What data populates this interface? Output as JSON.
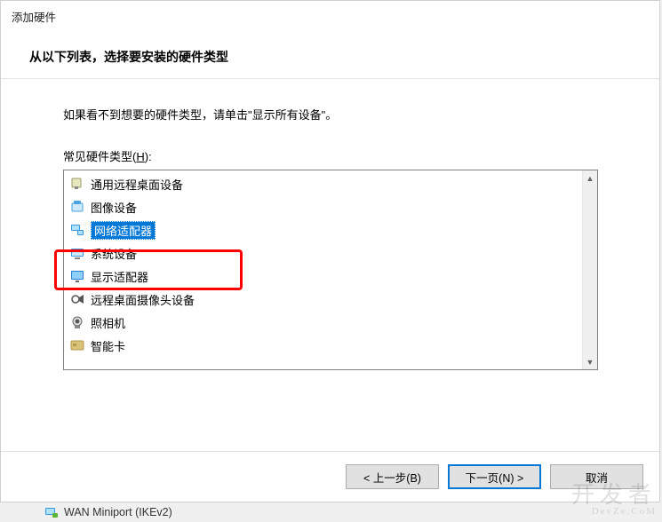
{
  "dialog": {
    "title": "添加硬件",
    "subtitle": "从以下列表，选择要安装的硬件类型",
    "hint": "如果看不到想要的硬件类型，请单击\"显示所有设备\"。",
    "list_label_prefix": "常见硬件类型(",
    "list_label_key": "H",
    "list_label_suffix": "):",
    "items": [
      {
        "label": "通用远程桌面设备",
        "icon": "device-generic"
      },
      {
        "label": "图像设备",
        "icon": "imaging"
      },
      {
        "label": "网络适配器",
        "icon": "network",
        "selected": true
      },
      {
        "label": "系统设备",
        "icon": "system"
      },
      {
        "label": "显示适配器",
        "icon": "display"
      },
      {
        "label": "远程桌面摄像头设备",
        "icon": "rd-camera"
      },
      {
        "label": "照相机",
        "icon": "camera"
      },
      {
        "label": "智能卡",
        "icon": "smartcard"
      }
    ],
    "buttons": {
      "back": "< 上一步(B)",
      "next": "下一页(N) >",
      "cancel": "取消"
    }
  },
  "watermark": {
    "main": "开发者",
    "sub": "DevZe.CoM"
  },
  "behind": {
    "label": "WAN Miniport (IKEv2)"
  }
}
